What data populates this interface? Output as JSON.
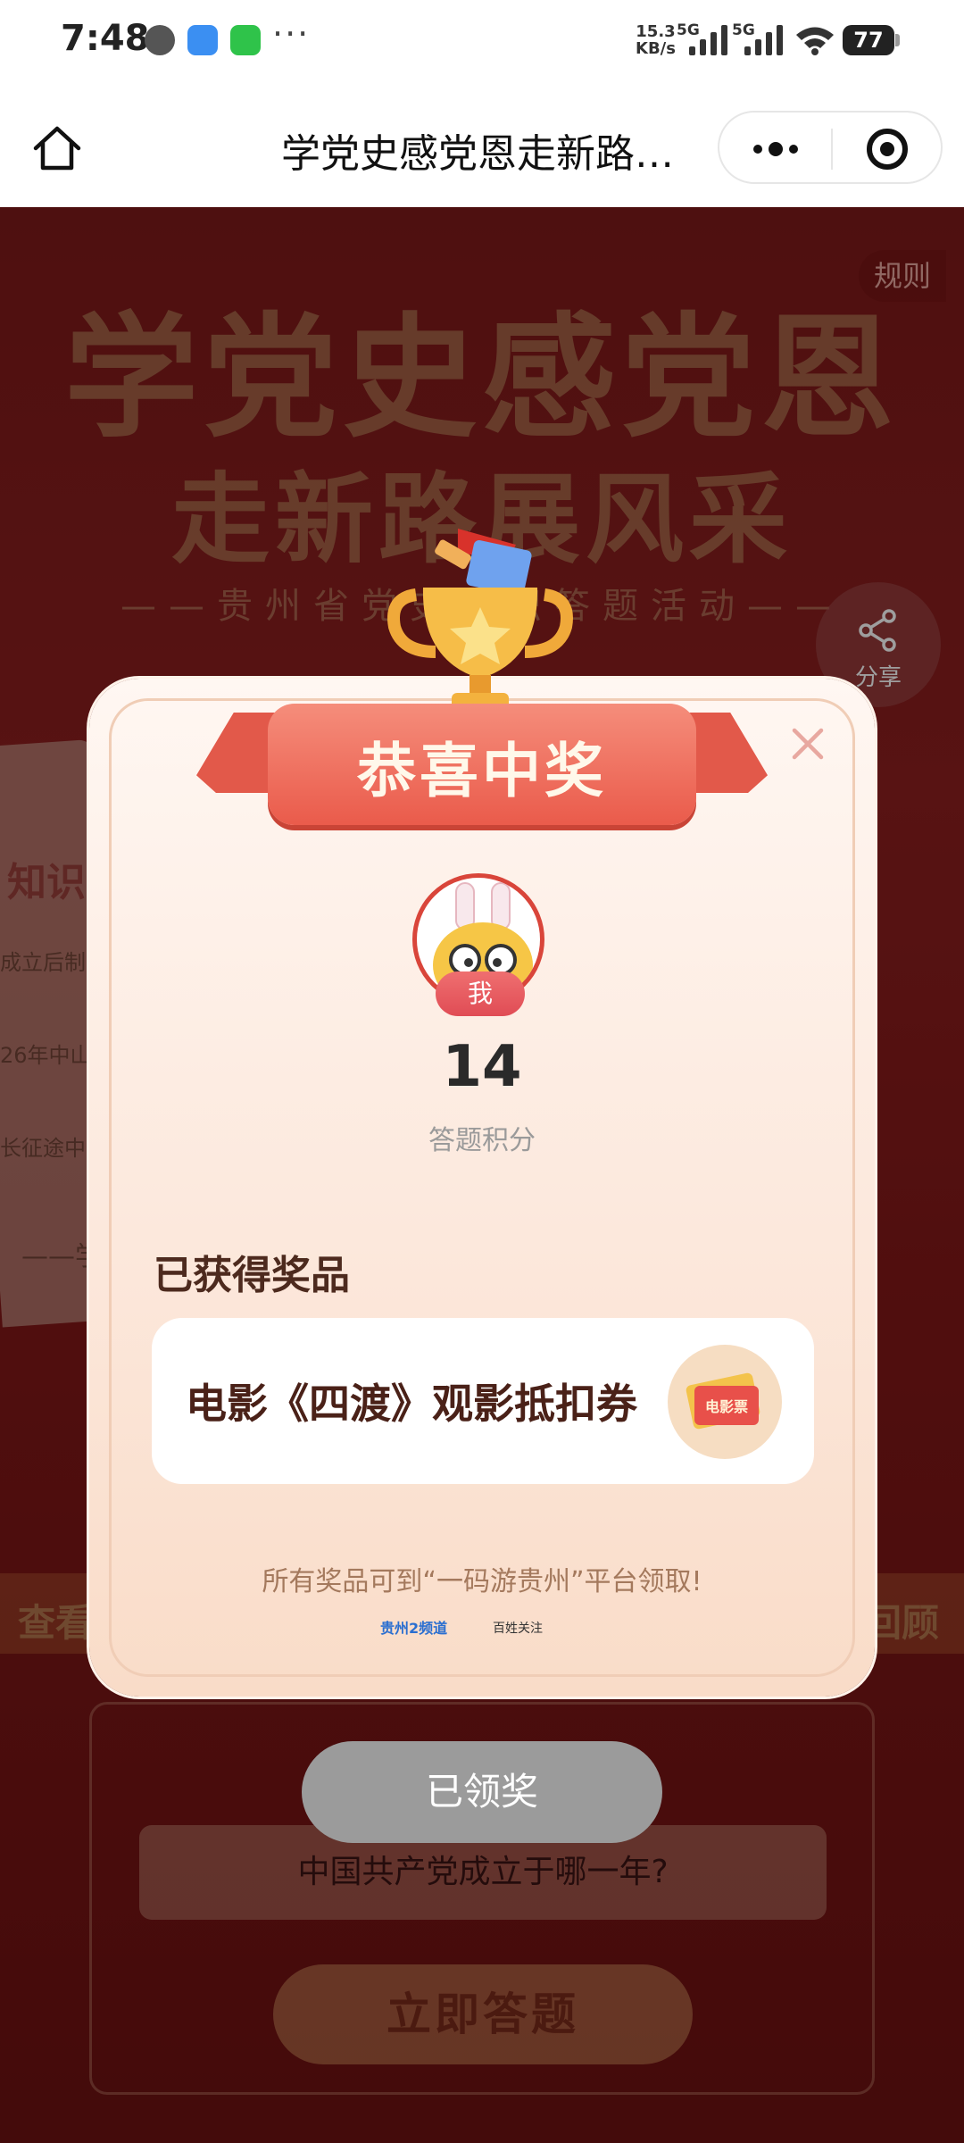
{
  "status_bar": {
    "time": "7:48",
    "speed_value": "15.3",
    "speed_unit": "KB/s",
    "net1": "5G",
    "net2": "5G",
    "battery": "77",
    "more": "···"
  },
  "navbar": {
    "title": "学党史感党恩走新路展风采",
    "home_icon": "home-icon",
    "more_icon": "more-dots-icon",
    "close_icon": "mini-program-close-icon"
  },
  "background": {
    "title_line1": "学党史感党恩",
    "title_line2": "走新路展风采",
    "subtitle": "——贵州省党史知识答题活动——",
    "rules_label": "规则",
    "share_label": "分享",
    "knowledge_head": "知识",
    "knowledge_lines": [
      "成立后制定",
      "26年中山",
      "长征途中",
      "——学"
    ],
    "band_left": "查看",
    "band_right": "回顾",
    "question": "中国共产党成立于哪一年?",
    "answer_button": "立即答题"
  },
  "modal": {
    "ribbon_text": "恭喜中奖",
    "me_tag": "我",
    "score": "14",
    "score_label": "答题积分",
    "prize_heading": "已获得奖品",
    "prize_name": "电影《四渡》观影抵扣券",
    "prize_icon_text": "电影票",
    "footer_note": "所有奖品可到“一码游贵州”平台领取!",
    "logo1_text": "贵州2频道",
    "logo2_text": "百姓关注",
    "claimed_button": "已领奖"
  },
  "colors": {
    "page_red": "#8e1f1f",
    "ribbon": "#ea5b4b",
    "claimed_gray": "#9b9b9b"
  }
}
